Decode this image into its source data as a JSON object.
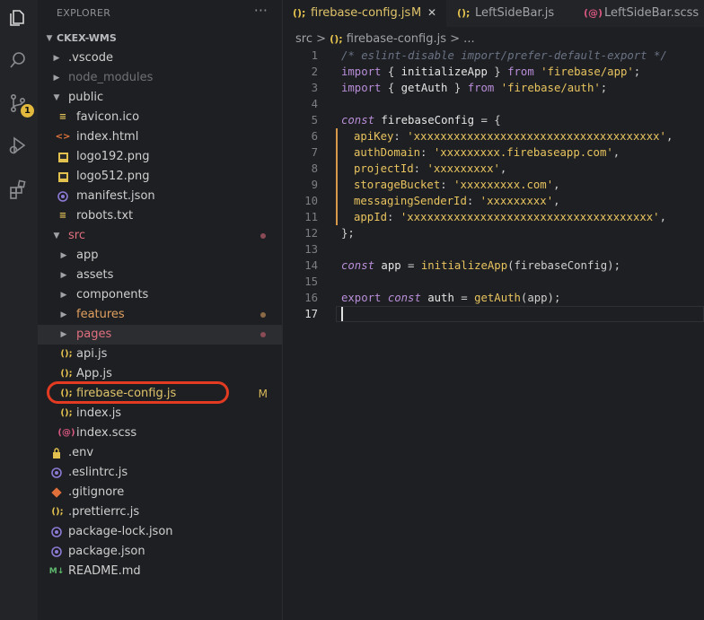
{
  "explorer": {
    "title": "EXPLORER",
    "more": "···",
    "root": "CKEX-WMS",
    "rows": [
      {
        "label": ".vscode",
        "kind": "folder",
        "open": false
      },
      {
        "label": "node_modules",
        "kind": "folder",
        "open": false
      },
      {
        "label": "public",
        "kind": "folder",
        "open": true
      },
      {
        "label": "favicon.ico",
        "kind": "ico"
      },
      {
        "label": "index.html",
        "kind": "html"
      },
      {
        "label": "logo192.png",
        "kind": "png"
      },
      {
        "label": "logo512.png",
        "kind": "png"
      },
      {
        "label": "manifest.json",
        "kind": "json"
      },
      {
        "label": "robots.txt",
        "kind": "txt"
      },
      {
        "label": "src",
        "kind": "folder",
        "open": true
      },
      {
        "label": "app",
        "kind": "folder"
      },
      {
        "label": "assets",
        "kind": "folder"
      },
      {
        "label": "components",
        "kind": "folder"
      },
      {
        "label": "features",
        "kind": "folder"
      },
      {
        "label": "pages",
        "kind": "folder"
      },
      {
        "label": "api.js",
        "kind": "js"
      },
      {
        "label": "App.js",
        "kind": "js"
      },
      {
        "label": "firebase-config.js",
        "kind": "js",
        "status": "M"
      },
      {
        "label": "index.js",
        "kind": "js"
      },
      {
        "label": "index.scss",
        "kind": "scss"
      },
      {
        "label": ".env",
        "kind": "env"
      },
      {
        "label": ".eslintrc.js",
        "kind": "eslint"
      },
      {
        "label": ".gitignore",
        "kind": "git"
      },
      {
        "label": ".prettierrc.js",
        "kind": "prettier"
      },
      {
        "label": "package-lock.json",
        "kind": "npm"
      },
      {
        "label": "package.json",
        "kind": "npm"
      },
      {
        "label": "README.md",
        "kind": "md"
      }
    ]
  },
  "activity_bar": {
    "icons": [
      "files-icon",
      "search-icon",
      "source-control-icon",
      "run-debug-icon",
      "extensions-icon"
    ],
    "scm_badge": "1"
  },
  "tabs": [
    {
      "label": "firebase-config.js",
      "status": "M",
      "close": "✕",
      "active": true
    },
    {
      "label": "LeftSideBar.js",
      "active": false
    },
    {
      "label": "LeftSideBar.scss",
      "active": false
    }
  ],
  "breadcrumb": {
    "folder": "src",
    "sep": ">",
    "file": "firebase-config.js",
    "more": "> ..."
  },
  "code": {
    "line_numbers": [
      "1",
      "2",
      "3",
      "4",
      "5",
      "6",
      "7",
      "8",
      "9",
      "10",
      "11",
      "12",
      "13",
      "14",
      "15",
      "16",
      "17"
    ],
    "current_line": "17",
    "l1": "/* eslint-disable import/prefer-default-export */",
    "l2": {
      "kw": "import",
      "a": " { ",
      "id": "initializeApp",
      "b": " } ",
      "from": "from",
      "str": "'firebase/app'",
      "end": ";"
    },
    "l3": {
      "kw": "import",
      "a": " { ",
      "id": "getAuth",
      "b": " } ",
      "from": "from",
      "str": "'firebase/auth'",
      "end": ";"
    },
    "l5": {
      "kw": "const",
      "id": " firebaseConfig",
      "rest": " = {"
    },
    "l6": {
      "key": "apiKey",
      "sep": ": ",
      "val": "'xxxxxxxxxxxxxxxxxxxxxxxxxxxxxxxxxxxxx'",
      "end": ","
    },
    "l7": {
      "key": "authDomain",
      "sep": ": ",
      "val": "'xxxxxxxxx.firebaseapp.com'",
      "end": ","
    },
    "l8": {
      "key": "projectId",
      "sep": ": ",
      "val": "'xxxxxxxxx'",
      "end": ","
    },
    "l9": {
      "key": "storageBucket",
      "sep": ": ",
      "val": "'xxxxxxxxx.com'",
      "end": ","
    },
    "l10": {
      "key": "messagingSenderId",
      "sep": ": ",
      "val": "'xxxxxxxxx'",
      "end": ","
    },
    "l11": {
      "key": "appId",
      "sep": ": ",
      "val": "'xxxxxxxxxxxxxxxxxxxxxxxxxxxxxxxxxxxxx'",
      "end": ","
    },
    "l12": "};",
    "l14": {
      "kw": "const",
      "id": " app",
      "eq": " = ",
      "fn": "initializeApp",
      "args": "(firebaseConfig);"
    },
    "l16": {
      "kw": "export",
      "kw2": " const",
      "id": " auth",
      "eq": " = ",
      "fn": "getAuth",
      "args": "(app);"
    }
  },
  "colors": {
    "accent_orange": "#d89a4a",
    "annotation_ring": "#e23b22",
    "modified": "#e0c46a"
  }
}
